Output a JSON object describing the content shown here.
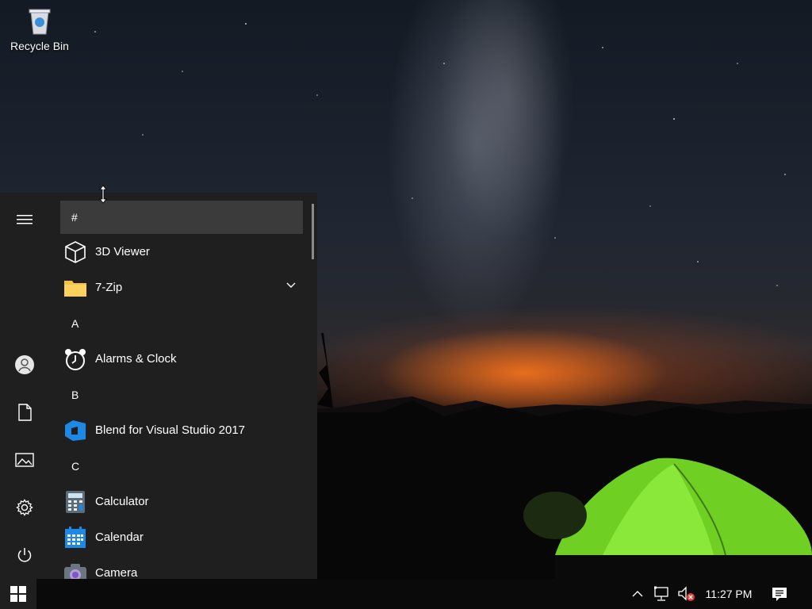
{
  "desktop": {
    "icons": [
      {
        "label": "Recycle Bin",
        "icon": "recycle-bin-icon"
      }
    ]
  },
  "start_menu": {
    "rail": [
      {
        "icon": "hamburger-menu-icon"
      },
      {
        "icon": "user-account-icon"
      },
      {
        "icon": "documents-icon"
      },
      {
        "icon": "pictures-icon"
      },
      {
        "icon": "settings-gear-icon"
      },
      {
        "icon": "power-icon"
      }
    ],
    "groups": {
      "hash": "#",
      "a": "A",
      "b": "B",
      "c": "C"
    },
    "apps": {
      "viewer3d": "3D Viewer",
      "zip7": "7-Zip",
      "alarms": "Alarms & Clock",
      "blend": "Blend for Visual Studio 2017",
      "calculator": "Calculator",
      "calendar": "Calendar",
      "camera": "Camera"
    }
  },
  "taskbar": {
    "start_icon": "windows-logo-icon",
    "tray": [
      {
        "icon": "chevron-up-icon"
      },
      {
        "icon": "network-icon"
      },
      {
        "icon": "volume-muted-icon"
      }
    ],
    "clock": "11:27 PM",
    "action_center_icon": "action-center-icon"
  },
  "colors": {
    "menu_bg": "#1f1f1f",
    "highlight": "#3b3b3b",
    "taskbar_bg": "#0a0a0a",
    "accent_blue": "#1e88e5",
    "folder_yellow": "#f6c243",
    "tent_green": "#7ee02c"
  }
}
